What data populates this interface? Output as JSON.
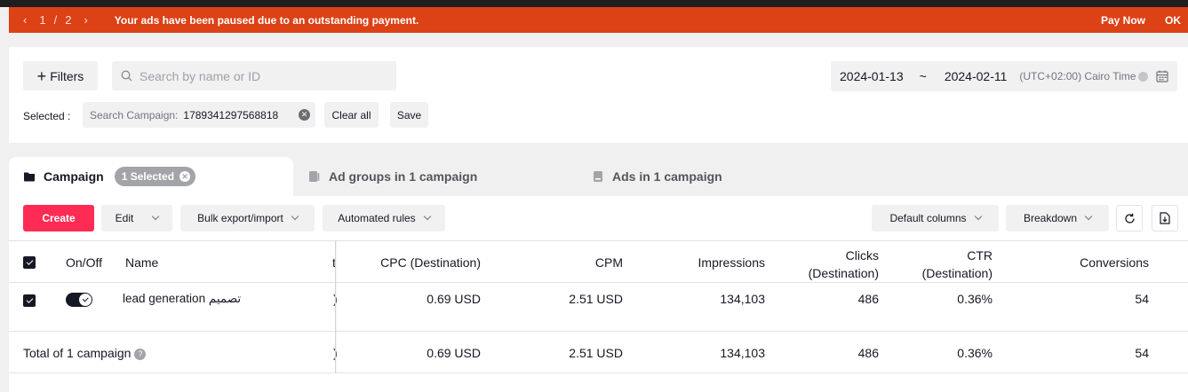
{
  "alert": {
    "page": "1",
    "sep": "/",
    "total": "2",
    "message": "Your ads have been paused due to an outstanding payment.",
    "pay_now": "Pay Now",
    "ok": "OK"
  },
  "filters": {
    "filters_label": "Filters",
    "search_placeholder": "Search by name or ID",
    "date_start": "2024-01-13",
    "date_sep": "~",
    "date_end": "2024-02-11",
    "timezone": "(UTC+02:00) Cairo Time",
    "selected_label": "Selected :",
    "chip_key": "Search Campaign:",
    "chip_value": "1789341297568818",
    "clear_all": "Clear all",
    "save": "Save"
  },
  "tabs": {
    "campaign": "Campaign",
    "campaign_badge": "1 Selected",
    "ad_groups": "Ad groups in 1 campaign",
    "ads": "Ads in 1 campaign"
  },
  "toolbar": {
    "create": "Create",
    "edit": "Edit",
    "bulk": "Bulk export/import",
    "rules": "Automated rules",
    "default_columns": "Default columns",
    "breakdown": "Breakdown"
  },
  "table": {
    "headers": {
      "onoff": "On/Off",
      "name": "Name",
      "cut": "t",
      "cpc": "CPC (Destination)",
      "cpm": "CPM",
      "impressions": "Impressions",
      "clicks_1": "Clicks",
      "clicks_2": "(Destination)",
      "ctr_1": "CTR",
      "ctr_2": "(Destination)",
      "conversions": "Conversions"
    },
    "row": {
      "name": "lead generation تصميم",
      "cut": ")",
      "cpc": "0.69 USD",
      "cpm": "2.51 USD",
      "impressions": "134,103",
      "clicks": "486",
      "ctr": "0.36%",
      "conversions": "54"
    },
    "total": {
      "label": "Total of 1 campaign",
      "cut": ")",
      "cpc": "0.69 USD",
      "cpm": "2.51 USD",
      "impressions": "134,103",
      "clicks": "486",
      "ctr": "0.36%",
      "conversions": "54"
    }
  }
}
